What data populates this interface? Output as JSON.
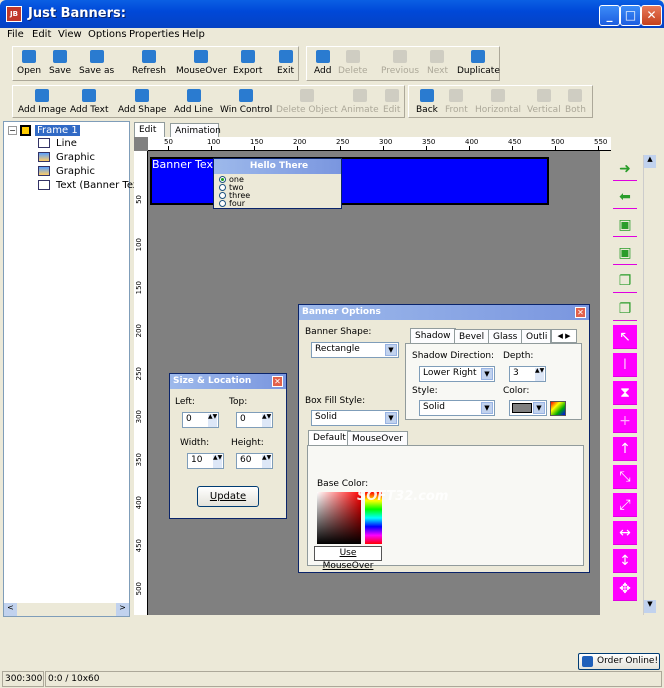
{
  "window": {
    "title": "Just Banners:"
  },
  "menu": [
    "File",
    "Edit",
    "View",
    "Options",
    "Properties",
    "Help"
  ],
  "toolbar1": {
    "group1": [
      {
        "label": "Open",
        "icon": "open-folder-icon",
        "enabled": true
      },
      {
        "label": "Save",
        "icon": "save-disk-icon",
        "enabled": true
      },
      {
        "label": "Save as",
        "icon": "save-as-disk-icon",
        "enabled": true
      },
      {
        "label": "Refresh",
        "icon": "refresh-icon",
        "enabled": true
      },
      {
        "label": "MouseOver",
        "icon": "mouseover-icon",
        "enabled": true
      },
      {
        "label": "Export",
        "icon": "export-icon",
        "enabled": true
      },
      {
        "label": "Exit",
        "icon": "exit-door-icon",
        "enabled": true
      }
    ],
    "group2": [
      {
        "label": "Add",
        "icon": "add-frame-icon",
        "enabled": true
      },
      {
        "label": "Delete",
        "icon": "delete-frame-icon",
        "enabled": false
      },
      {
        "label": "Previous",
        "icon": "previous-frame-icon",
        "enabled": false
      },
      {
        "label": "Next",
        "icon": "next-frame-icon",
        "enabled": false
      },
      {
        "label": "Duplicate",
        "icon": "duplicate-frame-icon",
        "enabled": true
      }
    ]
  },
  "toolbar2": {
    "group1": [
      {
        "label": "Add Image",
        "icon": "add-image-icon",
        "enabled": true
      },
      {
        "label": "Add Text",
        "icon": "add-text-icon",
        "enabled": true
      },
      {
        "label": "Add Shape",
        "icon": "add-shape-icon",
        "enabled": true
      },
      {
        "label": "Add Line",
        "icon": "add-line-icon",
        "enabled": true
      },
      {
        "label": "Win Control",
        "icon": "win-control-icon",
        "enabled": true
      },
      {
        "label": "Delete Object",
        "icon": "delete-object-icon",
        "enabled": false
      },
      {
        "label": "Animate",
        "icon": "animate-icon",
        "enabled": false
      },
      {
        "label": "Edit",
        "icon": "edit-icon",
        "enabled": false
      }
    ],
    "group2": [
      {
        "label": "Back",
        "icon": "send-back-icon",
        "enabled": true
      },
      {
        "label": "Front",
        "icon": "bring-front-icon",
        "enabled": false
      },
      {
        "label": "Horizontal",
        "icon": "align-horizontal-icon",
        "enabled": false
      },
      {
        "label": "Vertical",
        "icon": "align-vertical-icon",
        "enabled": false
      },
      {
        "label": "Both",
        "icon": "align-both-icon",
        "enabled": false
      }
    ]
  },
  "tree": {
    "root": "Frame 1",
    "children": [
      {
        "label": "Line",
        "icon": "line-icon"
      },
      {
        "label": "Graphic",
        "icon": "graphic-icon"
      },
      {
        "label": "Graphic",
        "icon": "graphic-icon"
      },
      {
        "label": "Text (Banner Tex",
        "icon": "text-icon"
      }
    ]
  },
  "editor_tabs": [
    "Edit",
    "Animation"
  ],
  "ruler": {
    "top": [
      "50",
      "100",
      "150",
      "200",
      "250",
      "300",
      "350",
      "400",
      "450",
      "500",
      "550"
    ],
    "left": [
      "50",
      "100",
      "150",
      "200",
      "250",
      "300",
      "350",
      "400",
      "450",
      "500"
    ]
  },
  "banner": {
    "text": "Banner Text",
    "color": "#0000ff",
    "popup_title": "Hello There",
    "options": [
      "one",
      "two",
      "three",
      "four"
    ],
    "selected": "one"
  },
  "size_panel": {
    "title": "Size & Location",
    "left_label": "Left:",
    "left": "0",
    "top_label": "Top:",
    "top": "0",
    "width_label": "Width:",
    "width": "10",
    "height_label": "Height:",
    "height": "60",
    "update": "Update"
  },
  "banner_options": {
    "title": "Banner Options",
    "shape_label": "Banner Shape:",
    "shape": "Rectangle",
    "tabs": [
      "Shadow",
      "Bevel",
      "Glass",
      "Outli"
    ],
    "shadow_dir_label": "Shadow Direction:",
    "shadow_dir": "Lower Right",
    "depth_label": "Depth:",
    "depth": "3",
    "style_label": "Style:",
    "style": "Solid",
    "color_label": "Color:",
    "fill_label": "Box Fill Style:",
    "fill": "Solid",
    "fill_tabs": [
      "Default",
      "MouseOver"
    ],
    "base_color_label": "Base Color:",
    "use_mouseover": "Use MouseOver",
    "watermark": "SOFT32.com"
  },
  "side_buttons": [
    {
      "icon": "arrow-right-icon",
      "enabled": true
    },
    {
      "icon": "arrow-left-icon",
      "enabled": true
    },
    {
      "icon": "paste-image-icon",
      "enabled": true
    },
    {
      "icon": "paste-image-icon",
      "enabled": true
    },
    {
      "icon": "copy-page-icon",
      "enabled": true
    },
    {
      "icon": "copy-page-icon",
      "enabled": true
    },
    {
      "icon": "pointer-icon",
      "enabled": true
    },
    {
      "icon": "text-cursor-icon",
      "enabled": false
    },
    {
      "icon": "hourglass-icon",
      "enabled": true
    },
    {
      "icon": "crosshair-icon",
      "enabled": false
    },
    {
      "icon": "arrow-up-icon",
      "enabled": true
    },
    {
      "icon": "resize-nwse-icon",
      "enabled": true
    },
    {
      "icon": "resize-nesw-icon",
      "enabled": true
    },
    {
      "icon": "resize-horizontal-icon",
      "enabled": true
    },
    {
      "icon": "resize-vertical-icon",
      "enabled": true
    },
    {
      "icon": "move-icon",
      "enabled": true
    }
  ],
  "status": {
    "size": "300:300",
    "pos": "0:0 / 10x60",
    "order_online": "Order Online!"
  }
}
